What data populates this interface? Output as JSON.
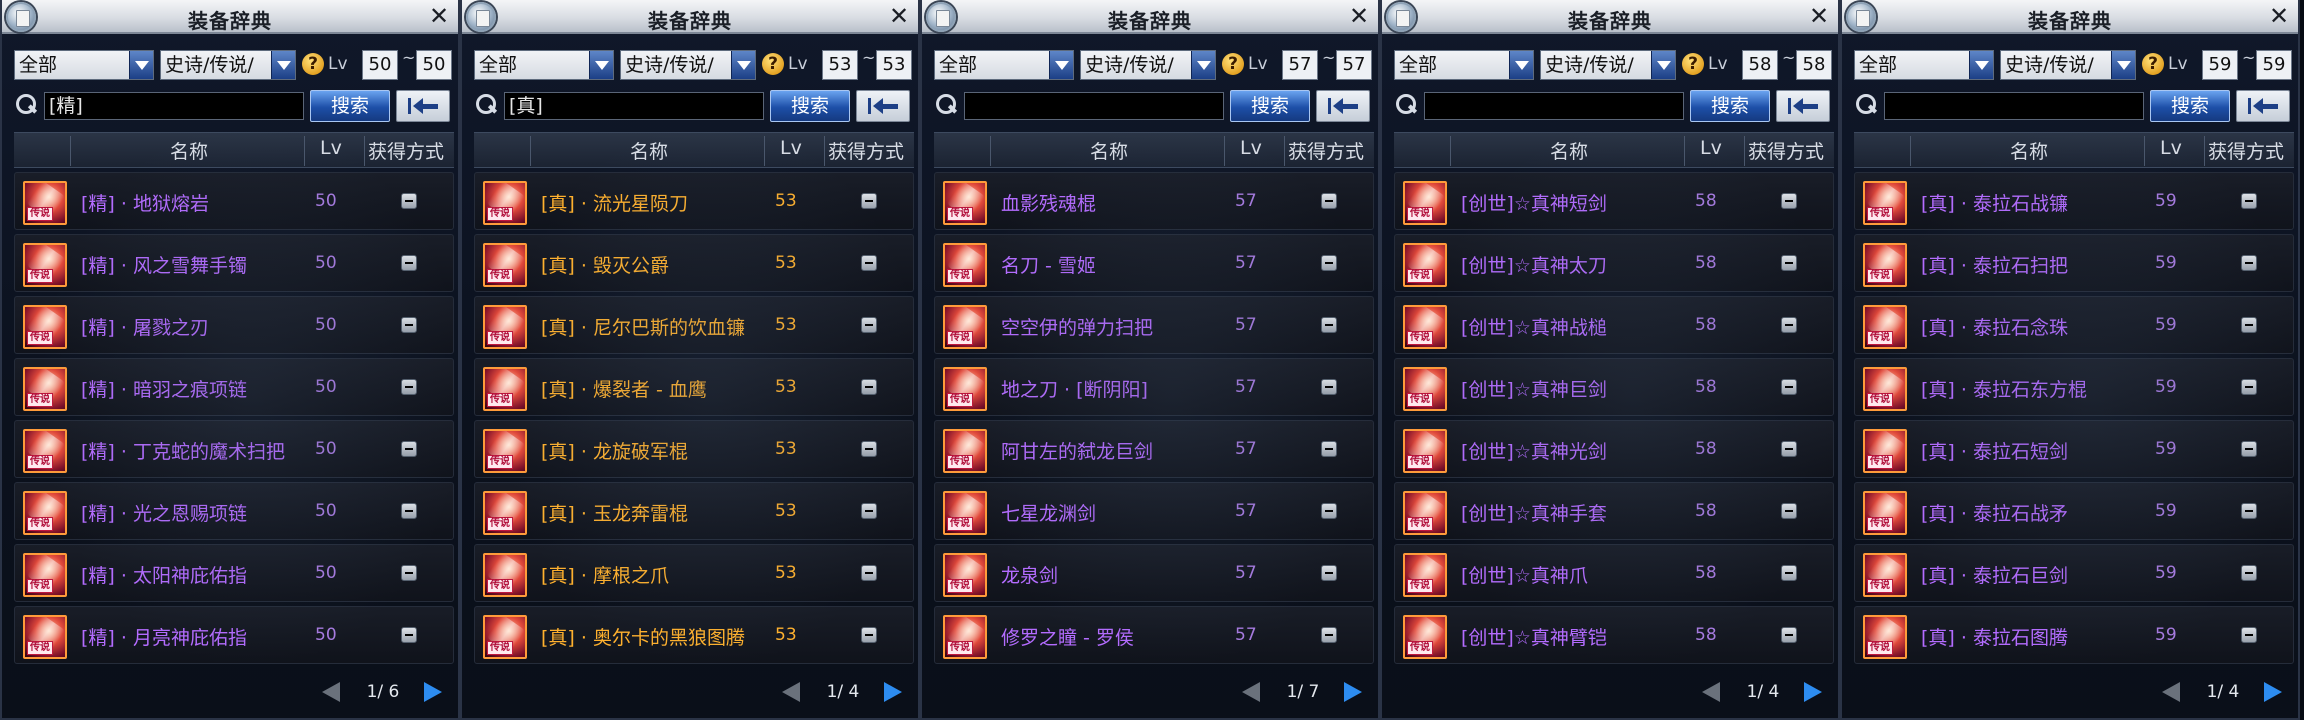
{
  "window_title": "装备辞典",
  "header": {
    "name": "名称",
    "lv": "Lv",
    "obtain": "获得方式"
  },
  "search_button": "搜索",
  "lv_label": "Lv",
  "colors": {
    "name_purple": "#b46cff",
    "name_orange": "#ffb12e",
    "lv_purple": "#a77be0",
    "lv_orange": "#ffb12e"
  },
  "panels": [
    {
      "category": "全部",
      "rarity": "史诗/传说/",
      "lv_min": "50",
      "lv_max": "50",
      "search": "[精]",
      "page": "1/ 6",
      "rarity_tone": "purple",
      "items": [
        {
          "name": "[精] · 地狱熔岩",
          "lv": "50",
          "badge": "传说"
        },
        {
          "name": "[精] · 风之雪舞手镯",
          "lv": "50",
          "badge": "传说"
        },
        {
          "name": "[精] · 屠戮之刃",
          "lv": "50",
          "badge": "传说"
        },
        {
          "name": "[精] · 暗羽之痕项链",
          "lv": "50",
          "badge": "传说"
        },
        {
          "name": "[精] · 丁克蛇的魔术扫把",
          "lv": "50",
          "badge": "传说"
        },
        {
          "name": "[精] · 光之恩赐项链",
          "lv": "50",
          "badge": "传说"
        },
        {
          "name": "[精] · 太阳神庇佑指",
          "lv": "50",
          "badge": "传说"
        },
        {
          "name": "[精] · 月亮神庇佑指",
          "lv": "50",
          "badge": "传说"
        }
      ]
    },
    {
      "category": "全部",
      "rarity": "史诗/传说/",
      "lv_min": "53",
      "lv_max": "53",
      "search": "[真]",
      "page": "1/ 4",
      "rarity_tone": "orange",
      "items": [
        {
          "name": "[真] · 流光星陨刀",
          "lv": "53",
          "badge": "传说"
        },
        {
          "name": "[真] · 毁灭公爵",
          "lv": "53",
          "badge": "传说"
        },
        {
          "name": "[真] · 尼尔巴斯的饮血镰",
          "lv": "53",
          "badge": "传说"
        },
        {
          "name": "[真] · 爆裂者 - 血鹰",
          "lv": "53",
          "badge": "传说"
        },
        {
          "name": "[真] · 龙旋破军棍",
          "lv": "53",
          "badge": "传说"
        },
        {
          "name": "[真] · 玉龙奔雷棍",
          "lv": "53",
          "badge": "传说"
        },
        {
          "name": "[真] · 摩根之爪",
          "lv": "53",
          "badge": "传说"
        },
        {
          "name": "[真] · 奥尔卡的黑狼图腾",
          "lv": "53",
          "badge": "传说"
        }
      ]
    },
    {
      "category": "全部",
      "rarity": "史诗/传说/",
      "lv_min": "57",
      "lv_max": "57",
      "search": "",
      "page": "1/ 7",
      "rarity_tone": "purple",
      "items": [
        {
          "name": "血影残魂棍",
          "lv": "57",
          "badge": "传说"
        },
        {
          "name": "名刀 - 雪姬",
          "lv": "57",
          "badge": "传说"
        },
        {
          "name": "空空伊的弹力扫把",
          "lv": "57",
          "badge": "传说"
        },
        {
          "name": "地之刀 · [断阴阳]",
          "lv": "57",
          "badge": "传说"
        },
        {
          "name": "阿甘左的弑龙巨剑",
          "lv": "57",
          "badge": "传说"
        },
        {
          "name": "七星龙渊剑",
          "lv": "57",
          "badge": "传说"
        },
        {
          "name": "龙泉剑",
          "lv": "57",
          "badge": "传说"
        },
        {
          "name": "修罗之瞳 - 罗侯",
          "lv": "57",
          "badge": "传说"
        }
      ]
    },
    {
      "category": "全部",
      "rarity": "史诗/传说/",
      "lv_min": "58",
      "lv_max": "58",
      "search": "",
      "page": "1/ 4",
      "rarity_tone": "purple",
      "items": [
        {
          "name": "[创世]☆真神短剑",
          "lv": "58",
          "badge": "传说"
        },
        {
          "name": "[创世]☆真神太刀",
          "lv": "58",
          "badge": "传说"
        },
        {
          "name": "[创世]☆真神战槌",
          "lv": "58",
          "badge": "传说"
        },
        {
          "name": "[创世]☆真神巨剑",
          "lv": "58",
          "badge": "传说"
        },
        {
          "name": "[创世]☆真神光剑",
          "lv": "58",
          "badge": "传说"
        },
        {
          "name": "[创世]☆真神手套",
          "lv": "58",
          "badge": "传说"
        },
        {
          "name": "[创世]☆真神爪",
          "lv": "58",
          "badge": "传说"
        },
        {
          "name": "[创世]☆真神臂铠",
          "lv": "58",
          "badge": "传说"
        }
      ]
    },
    {
      "category": "全部",
      "rarity": "史诗/传说/",
      "lv_min": "59",
      "lv_max": "59",
      "search": "",
      "page": "1/ 4",
      "rarity_tone": "purple",
      "items": [
        {
          "name": "[真] · 泰拉石战镰",
          "lv": "59",
          "badge": "传说"
        },
        {
          "name": "[真] · 泰拉石扫把",
          "lv": "59",
          "badge": "传说"
        },
        {
          "name": "[真] · 泰拉石念珠",
          "lv": "59",
          "badge": "传说"
        },
        {
          "name": "[真] · 泰拉石东方棍",
          "lv": "59",
          "badge": "传说"
        },
        {
          "name": "[真] · 泰拉石短剑",
          "lv": "59",
          "badge": "传说"
        },
        {
          "name": "[真] · 泰拉石战矛",
          "lv": "59",
          "badge": "传说"
        },
        {
          "name": "[真] · 泰拉石巨剑",
          "lv": "59",
          "badge": "传说"
        },
        {
          "name": "[真] · 泰拉石图腾",
          "lv": "59",
          "badge": "传说"
        }
      ]
    }
  ]
}
